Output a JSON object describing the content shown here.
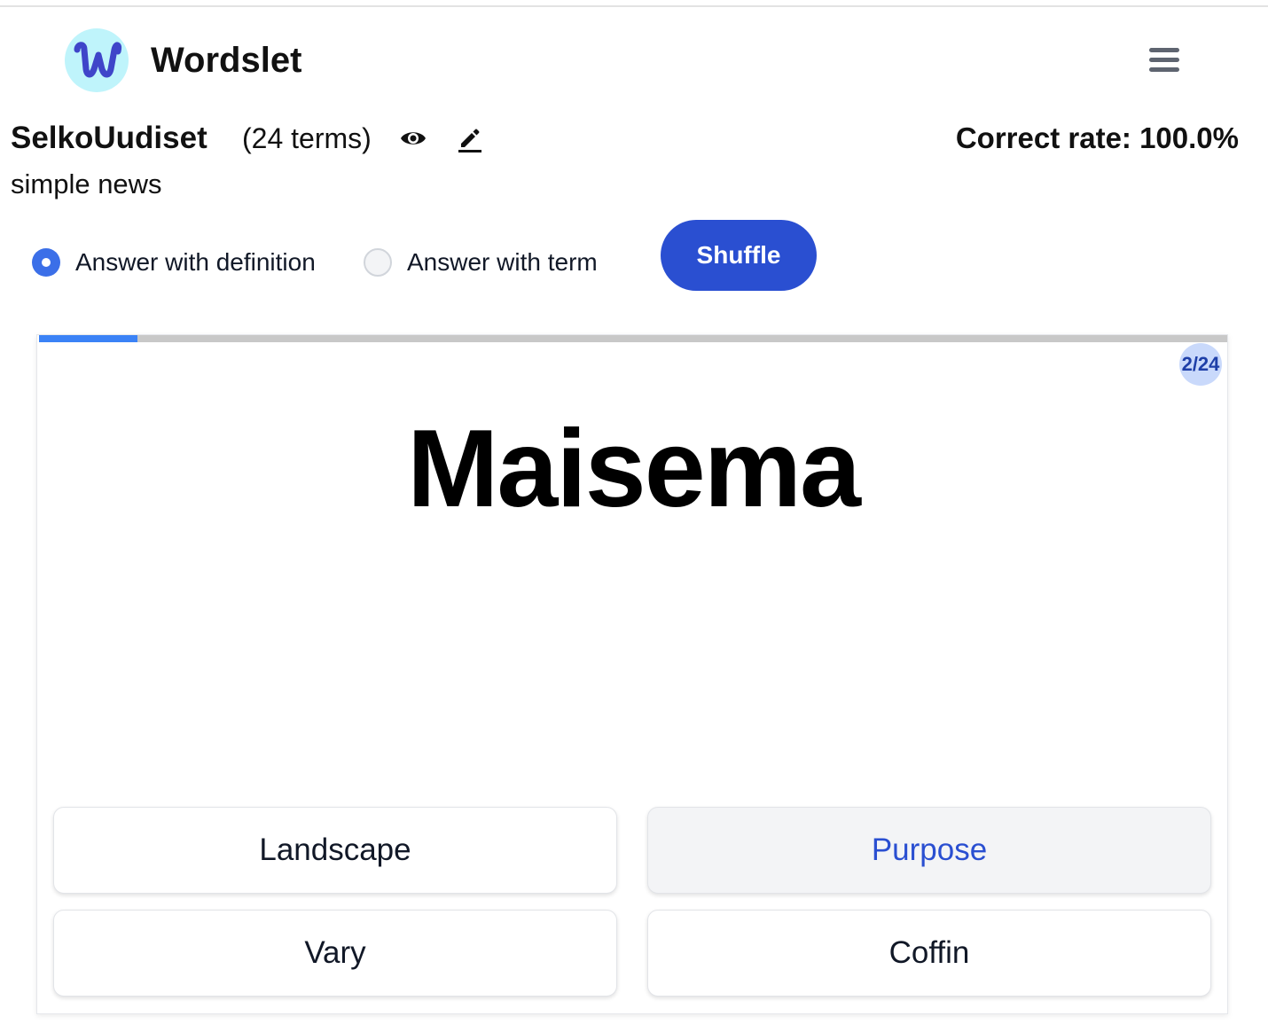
{
  "app": {
    "name": "Wordslet",
    "logo_letter": "w"
  },
  "set": {
    "title": "SelkoUudiset",
    "term_count": "(24 terms)",
    "description": "simple news"
  },
  "stats": {
    "correct_rate": "Correct rate: 100.0%"
  },
  "options": {
    "answer_with_definition": "Answer with definition",
    "answer_with_term": "Answer with term",
    "selected": "answer_with_definition",
    "shuffle_label": "Shuffle"
  },
  "quiz": {
    "progress_fraction": 0.083,
    "counter": "2/24",
    "term": "Maisema",
    "answers": [
      "Landscape",
      "Purpose",
      "Vary",
      "Coffin"
    ],
    "hovered_answer": "Purpose"
  },
  "colors": {
    "primary": "#2a4fd1",
    "progress": "#3b82f6",
    "logo_bg": "#bff4fb",
    "logo_fg": "#3f45c9"
  },
  "icons": [
    "menu-icon",
    "eye-icon",
    "pencil-icon"
  ]
}
